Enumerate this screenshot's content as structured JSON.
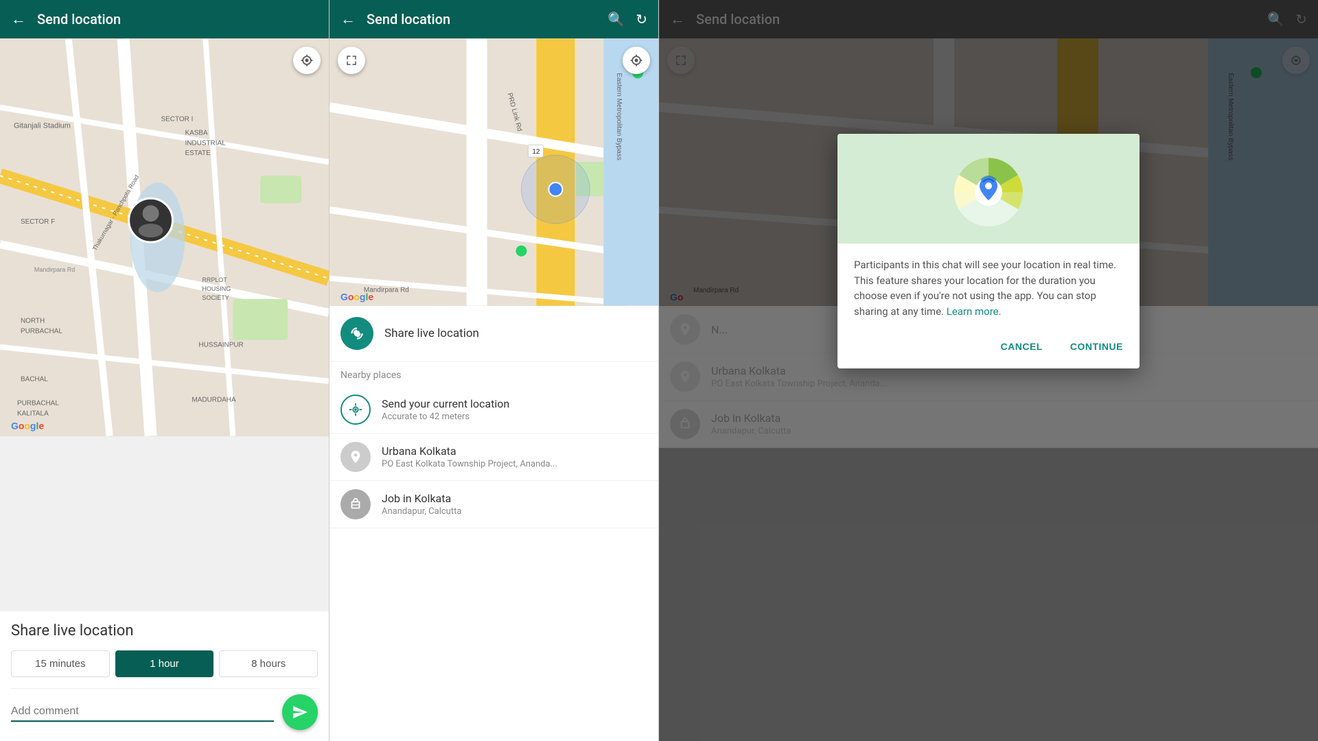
{
  "panel1": {
    "header": {
      "title": "Send location",
      "back_icon": "←"
    },
    "share_live_title": "Share live location",
    "duration_buttons": [
      {
        "label": "15 minutes",
        "active": false
      },
      {
        "label": "1 hour",
        "active": true
      },
      {
        "label": "8 hours",
        "active": false
      }
    ],
    "comment_placeholder": "Add comment",
    "send_icon": "▶"
  },
  "panel2": {
    "header": {
      "title": "Send location",
      "back_icon": "←",
      "search_icon": "🔍",
      "refresh_icon": "↻"
    },
    "share_live_label": "Share live location",
    "nearby_label": "Nearby places",
    "locations": [
      {
        "name": "Send your current location",
        "sub": "Accurate to 42 meters",
        "type": "current"
      },
      {
        "name": "Urbana Kolkata",
        "sub": "PO East Kolkata Township Project, Ananda...",
        "type": "place"
      },
      {
        "name": "Job in Kolkata",
        "sub": "Anandapur, Calcutta",
        "type": "job"
      }
    ]
  },
  "panel3": {
    "header": {
      "title": "Send location",
      "back_icon": "←",
      "search_icon": "🔍",
      "refresh_icon": "↻"
    },
    "dialog": {
      "body_text": "Participants in this chat will see your location in real time. This feature shares your location for the duration you choose even if you're not using the app. You can stop sharing at any time.",
      "learn_more": "Learn more.",
      "cancel_label": "CANCEL",
      "continue_label": "CONTINUE"
    },
    "locations": [
      {
        "name": "Urbana Kolkata",
        "sub": "PO East Kolkata Township Project, Ananda...",
        "type": "place"
      },
      {
        "name": "Job in Kolkata",
        "sub": "Anandapur, Calcutta",
        "type": "job"
      }
    ]
  }
}
